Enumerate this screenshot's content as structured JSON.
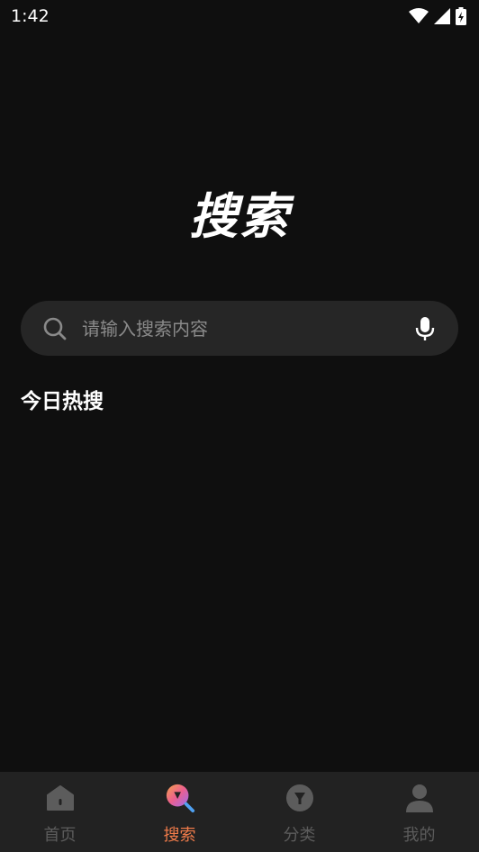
{
  "status_bar": {
    "time": "1:42",
    "icons": [
      "wifi-icon",
      "signal-icon",
      "battery-icon"
    ]
  },
  "page": {
    "title": "搜索"
  },
  "search": {
    "placeholder": "请输入搜索内容",
    "value": "",
    "icons": [
      "search-icon",
      "mic-icon"
    ]
  },
  "hot_search": {
    "title": "今日热搜",
    "items": []
  },
  "tab_bar": {
    "active_index": 1,
    "active_color": "#f07b4a",
    "inactive_color": "#5c5c5c",
    "tabs": [
      {
        "label": "首页",
        "icon": "home-icon"
      },
      {
        "label": "搜索",
        "icon": "search-tab-icon"
      },
      {
        "label": "分类",
        "icon": "category-icon"
      },
      {
        "label": "我的",
        "icon": "profile-icon"
      }
    ]
  },
  "colors": {
    "background": "#0f0f0f",
    "search_bar": "#262626",
    "tab_bar": "#222222"
  }
}
